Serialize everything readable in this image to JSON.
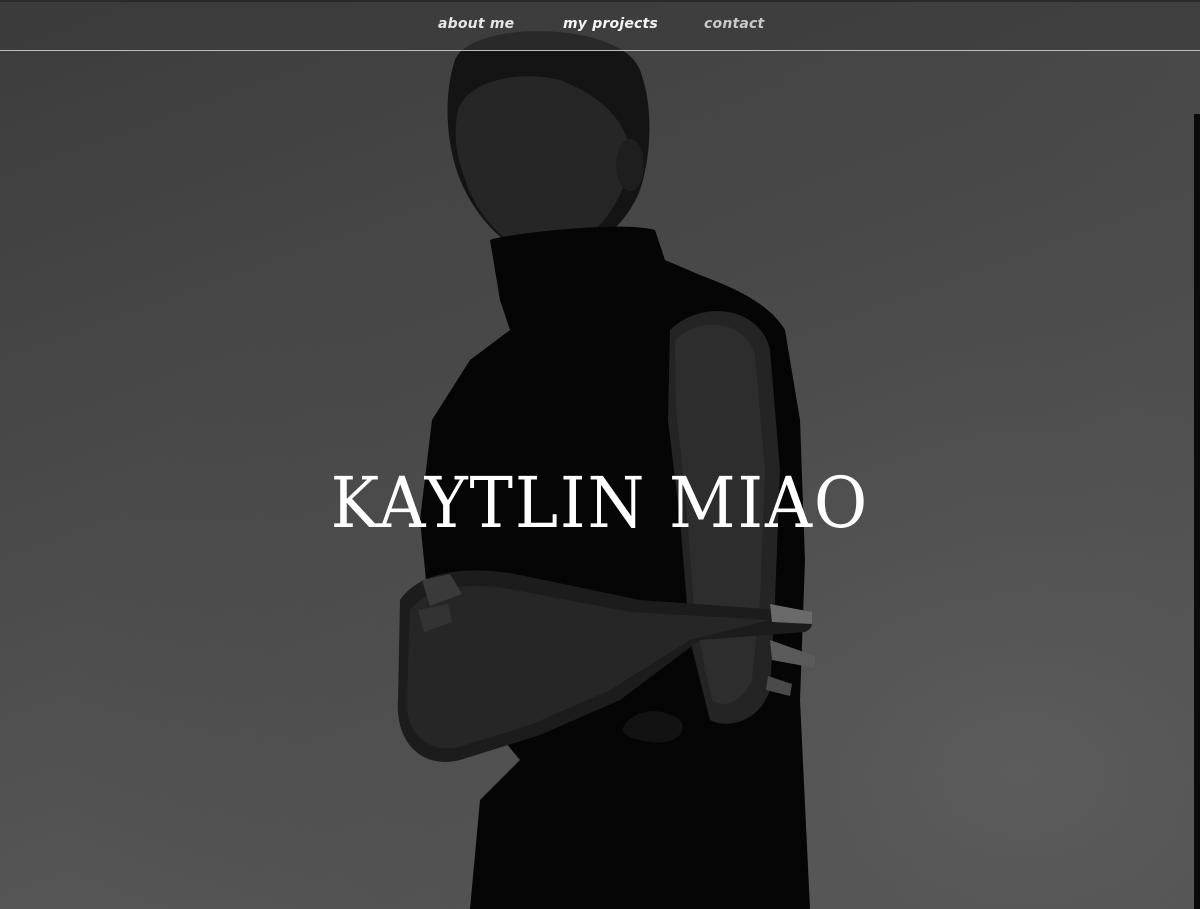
{
  "nav": {
    "items": [
      {
        "label": "about me"
      },
      {
        "label": "my projects"
      },
      {
        "label": "contact"
      }
    ]
  },
  "hero": {
    "name": "KAYTLIN MIAO",
    "background_color": "#4a4a4a",
    "subject_color": "#050505",
    "image_name": "portrait-photo"
  }
}
